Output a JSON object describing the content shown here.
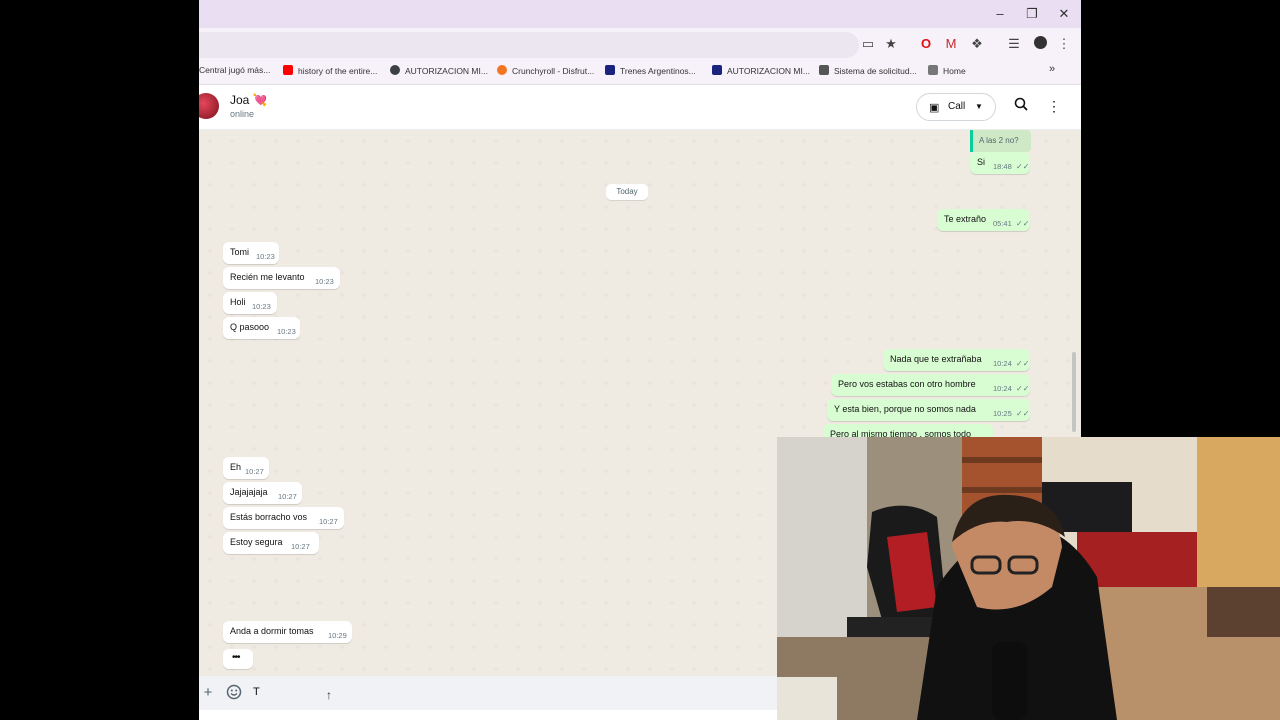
{
  "browser": {
    "bookmarks": [
      {
        "label": "Central jugó más...",
        "color": "#1e88e5"
      },
      {
        "label": "history of the entire...",
        "color": "#ff0000"
      },
      {
        "label": "AUTORIZACION MI...",
        "color": "#3c4043"
      },
      {
        "label": "Crunchyroll - Disfrut...",
        "color": "#f47521"
      },
      {
        "label": "Trenes Argentinos...",
        "color": "#1a237e"
      },
      {
        "label": "AUTORIZACION MI...",
        "color": "#1a237e"
      },
      {
        "label": "Sistema de solicitud...",
        "color": "#555555"
      },
      {
        "label": "Home",
        "color": "#555555"
      }
    ],
    "overflow_icon": "»"
  },
  "contact": {
    "name": "Joa 💘",
    "status": "online"
  },
  "header": {
    "call_label": "Call"
  },
  "chat": {
    "quoted_text": "A las 2 no?",
    "date_separator": "Today",
    "messages": [
      {
        "dir": "out",
        "text": "Si",
        "time": "18:48",
        "ticks": "✓✓"
      },
      {
        "dir": "out",
        "text": "Te extraño",
        "time": "05:41",
        "ticks": "✓✓"
      },
      {
        "dir": "in",
        "text": "Tomi",
        "time": "10:23"
      },
      {
        "dir": "in",
        "text": "Recién me levanto",
        "time": "10:23"
      },
      {
        "dir": "in",
        "text": "Holi",
        "time": "10:23"
      },
      {
        "dir": "in",
        "text": "Q pasooo",
        "time": "10:23"
      },
      {
        "dir": "out",
        "text": "Nada que te extrañaba",
        "time": "10:24",
        "ticks": "✓✓"
      },
      {
        "dir": "out",
        "text": "Pero vos estabas con otro hombre",
        "time": "10:24",
        "ticks": "✓✓"
      },
      {
        "dir": "out",
        "text": "Y esta bien, porque no somos nada",
        "time": "10:25",
        "ticks": "✓✓"
      },
      {
        "dir": "out",
        "text": "Pero al mismo tiempo , somos todo",
        "time": "",
        "ticks": ""
      },
      {
        "dir": "in",
        "text": "Eh",
        "time": "10:27"
      },
      {
        "dir": "in",
        "text": "Jajajajaja",
        "time": "10:27"
      },
      {
        "dir": "in",
        "text": "Estás borracho vos",
        "time": "10:27"
      },
      {
        "dir": "in",
        "text": "Estoy segura",
        "time": "10:27"
      },
      {
        "dir": "in",
        "text": "Anda a dormir tomas",
        "time": "10:29"
      },
      {
        "dir": "in",
        "text": "•••",
        "time": ""
      }
    ]
  },
  "composer": {
    "typed_text": "T"
  }
}
